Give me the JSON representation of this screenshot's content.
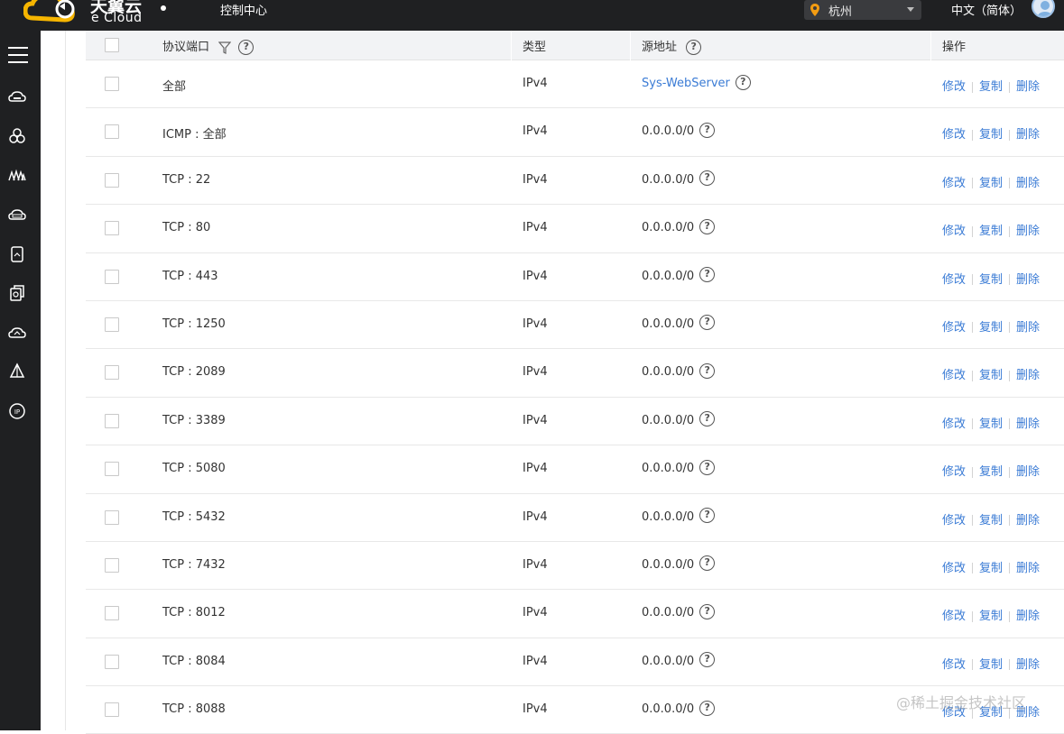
{
  "header": {
    "logo_cn": "天翼云",
    "logo_en": "e Cloud",
    "console_label": "控制中心",
    "region": "杭州",
    "language": "中文（简体）"
  },
  "sidebar": {
    "items": [
      "menu-icon",
      "cloud-host-icon",
      "cluster-icon",
      "mountain-icon",
      "cloud-disk-icon",
      "storage-icon",
      "backup-icon",
      "cloud-link-icon",
      "drive-icon",
      "ip-icon"
    ]
  },
  "table": {
    "headers": {
      "port": "协议端口",
      "type": "类型",
      "source": "源地址",
      "actions": "操作"
    },
    "action_labels": {
      "edit": "修改",
      "copy": "复制",
      "delete": "删除"
    },
    "rows": [
      {
        "port": "全部",
        "type": "IPv4",
        "source": "Sys-WebServer"
      },
      {
        "port": "ICMP : 全部",
        "type": "IPv4",
        "source": "0.0.0.0/0"
      },
      {
        "port": "TCP : 22",
        "type": "IPv4",
        "source": "0.0.0.0/0"
      },
      {
        "port": "TCP : 80",
        "type": "IPv4",
        "source": "0.0.0.0/0"
      },
      {
        "port": "TCP : 443",
        "type": "IPv4",
        "source": "0.0.0.0/0"
      },
      {
        "port": "TCP : 1250",
        "type": "IPv4",
        "source": "0.0.0.0/0"
      },
      {
        "port": "TCP : 2089",
        "type": "IPv4",
        "source": "0.0.0.0/0"
      },
      {
        "port": "TCP : 3389",
        "type": "IPv4",
        "source": "0.0.0.0/0"
      },
      {
        "port": "TCP : 5080",
        "type": "IPv4",
        "source": "0.0.0.0/0"
      },
      {
        "port": "TCP : 5432",
        "type": "IPv4",
        "source": "0.0.0.0/0"
      },
      {
        "port": "TCP : 7432",
        "type": "IPv4",
        "source": "0.0.0.0/0"
      },
      {
        "port": "TCP : 8012",
        "type": "IPv4",
        "source": "0.0.0.0/0"
      },
      {
        "port": "TCP : 8084",
        "type": "IPv4",
        "source": "0.0.0.0/0"
      },
      {
        "port": "TCP : 8088",
        "type": "IPv4",
        "source": "0.0.0.0/0"
      }
    ]
  },
  "watermark": "@稀土掘金技术社区",
  "colors": {
    "topbar": "#1f2022",
    "link": "#3a7bd5",
    "header_bg": "#f2f3f5",
    "logo_accent": "#f6b500"
  }
}
